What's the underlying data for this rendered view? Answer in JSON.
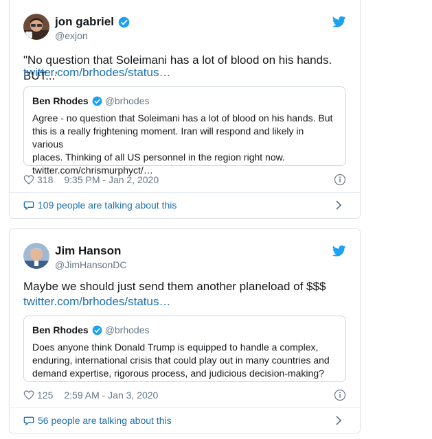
{
  "tweets": [
    {
      "author_name": "jon gabriel",
      "author_handle": "@exjon",
      "text": "\"No question that Soleimani has a lot of blood on his hands. BUT...\"",
      "link": "twitter.com/brhodes/status…",
      "quote": {
        "author_name": "Ben Rhodes",
        "author_handle": "@brhodes",
        "text_lines": [
          "Agree - no question that Soleimani has a lot of blood on his hands. But",
          "this is a really frightening moment. Iran will respond and likely in various",
          "places. Thinking of all US personnel in the region right now.",
          "twitter.com/chrismurphyct/…"
        ]
      },
      "likes": "318",
      "timestamp": "9:35 PM - Jan 2, 2020",
      "talking": "109 people are talking about this"
    },
    {
      "author_name": "Jim Hanson",
      "author_handle": "@JimHansonDC",
      "text": "Maybe we should just send them another planeload of $$$",
      "link": "twitter.com/brhodes/status…",
      "quote": {
        "author_name": "Ben Rhodes",
        "author_handle": "@brhodes",
        "text_lines": [
          "Does anyone think Donald Trump is equipped to handle a complex,",
          "enduring, international crisis that could play out in many countries and",
          "demand expertise, rigorous process, and judicious decision-making?"
        ]
      },
      "likes": "125",
      "timestamp": "2:59 AM - Jan 3, 2020",
      "talking": "56 people are talking about this"
    }
  ],
  "colors": {
    "accent": "#1da1f2",
    "link": "#1b6faf",
    "muted": "#657786",
    "border": "#dfe3e6"
  },
  "icons": [
    "verified-badge-icon",
    "twitter-bird-icon",
    "heart-icon",
    "info-icon",
    "comment-bubble-icon",
    "chevron-right-icon"
  ]
}
